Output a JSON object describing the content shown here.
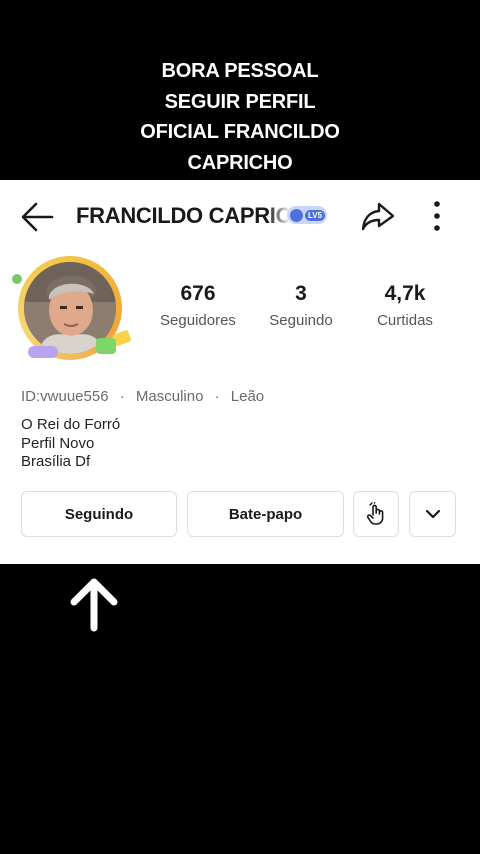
{
  "caption": {
    "lines": [
      "BORA PESSOAL",
      "SEGUIR PERFIL",
      "OFICIAL FRANCILDO",
      "CAPRICHO"
    ]
  },
  "profile": {
    "name": "FRANCILDO CAPRICHO",
    "level_badge": "LV5",
    "stats": [
      {
        "value": "676",
        "label": "Seguidores"
      },
      {
        "value": "3",
        "label": "Seguindo"
      },
      {
        "value": "4,7k",
        "label": "Curtidas"
      }
    ],
    "meta": {
      "id": "ID:vwuue556",
      "separator": "·",
      "gender": "Masculino",
      "sign": "Leão"
    },
    "bio": [
      "O Rei do Forró",
      "Perfil Novo",
      "Brasília Df"
    ]
  },
  "actions": {
    "following_label": "Seguindo",
    "chat_label": "Bate-papo"
  },
  "icons": {
    "back": "arrow-left-icon",
    "share": "share-icon",
    "more": "vertical-dots-icon",
    "gift": "hand-tap-icon",
    "dropdown": "chevron-down-icon",
    "pointer": "arrow-up-icon"
  },
  "colors": {
    "background": "#000000",
    "card": "#ffffff",
    "caption_text": "#ffffff",
    "avatar_ring": "#f4c443",
    "level_badge": "#4f6fe0"
  }
}
